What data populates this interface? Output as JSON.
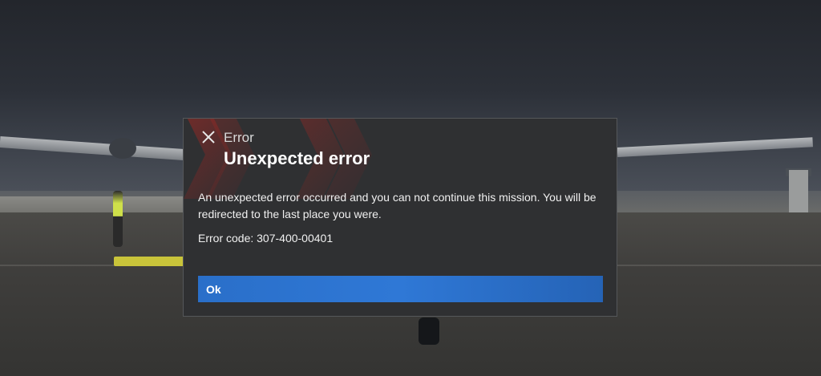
{
  "dialog": {
    "eyebrow": "Error",
    "title": "Unexpected error",
    "message": "An unexpected error occurred and you can not continue this mission. You will be redirected to the last place you were.",
    "error_code": "Error code: 307-400-00401",
    "ok_label": "Ok",
    "close_icon": "close-icon",
    "accent_color": "#2f78d6"
  }
}
